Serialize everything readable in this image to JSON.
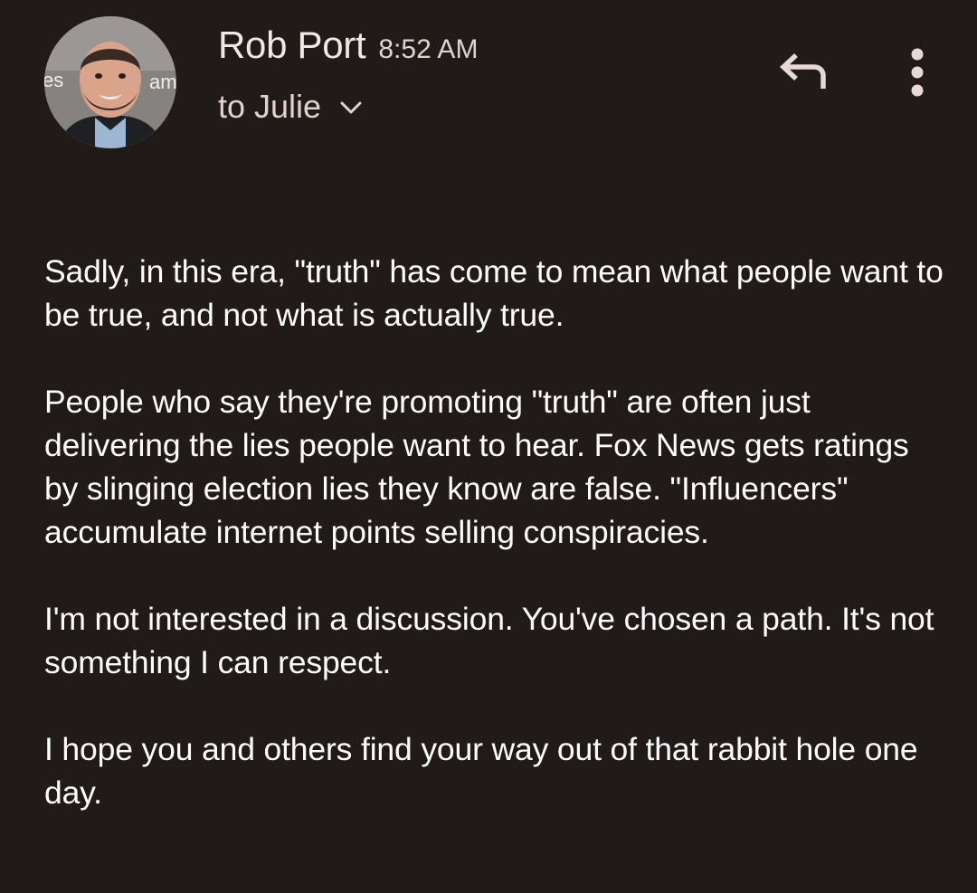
{
  "header": {
    "sender_name": "Rob Port",
    "time": "8:52 AM",
    "recipient": "to Julie",
    "avatar_caption_left": "es",
    "avatar_caption_right": "am"
  },
  "icons": {
    "reply": "reply-icon",
    "more": "more-vertical-icon",
    "chevron": "chevron-down-icon"
  },
  "colors": {
    "background": "#201a18",
    "text_primary": "#ffffff",
    "text_secondary": "#e0d2cc"
  },
  "body": {
    "paragraphs": [
      "Sadly, in this era, \"truth\" has come to mean what people want to be true, and not what is actually true.",
      "People who say they're promoting \"truth\" are often just delivering the lies people want to hear. Fox News gets ratings by slinging election lies they know are false. \"Influencers\" accumulate internet points selling conspiracies.",
      "I'm not interested in a discussion. You've chosen a path. It's not something I can respect.",
      "I hope you and others find your way out of that rabbit hole one day."
    ]
  }
}
